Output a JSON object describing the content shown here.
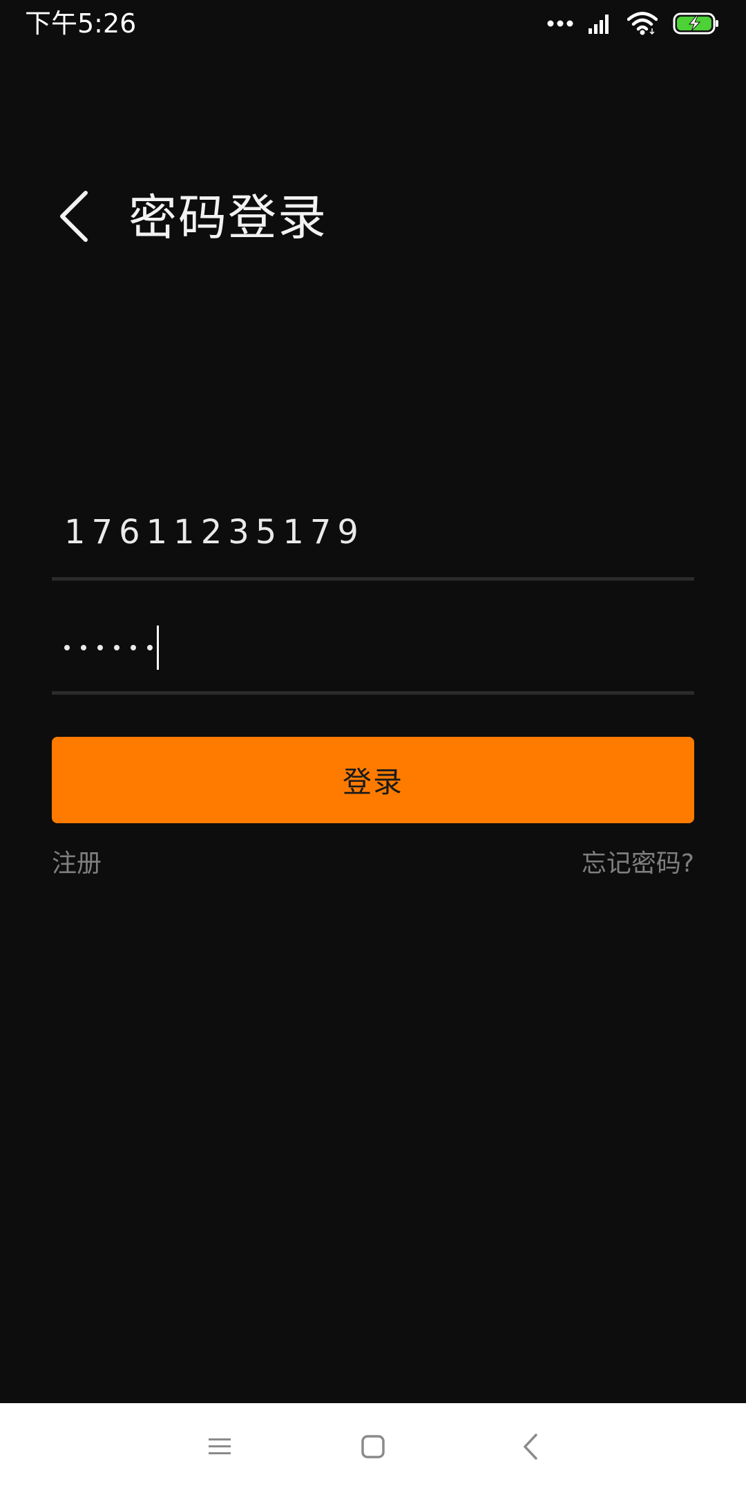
{
  "status_bar": {
    "time": "下午5:26",
    "icons": [
      "more-dots-icon",
      "signal-icon",
      "wifi-icon",
      "battery-charging-icon"
    ],
    "battery_color": "#4cd137"
  },
  "header": {
    "title": "密码登录",
    "back_icon": "chevron-left-icon"
  },
  "form": {
    "phone_value": "17611235179",
    "password_mask_count": 6
  },
  "actions": {
    "login_label": "登录",
    "register_label": "注册",
    "forgot_label": "忘记密码?"
  },
  "nav_bar": {
    "buttons": [
      "menu-icon",
      "home-icon",
      "back-icon"
    ]
  },
  "colors": {
    "background": "#0d0d0d",
    "accent": "#ff7b00",
    "link": "#7f7f7f",
    "text": "#eaeaea"
  }
}
